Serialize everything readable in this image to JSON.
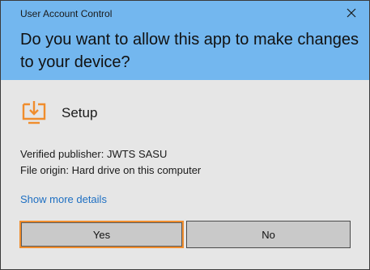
{
  "window": {
    "title": "User Account Control",
    "close_icon": "close-icon"
  },
  "prompt": {
    "question": "Do you want to allow this app to make changes to your device?"
  },
  "app": {
    "icon": "setup-installer-icon",
    "name": "Setup",
    "accent_color": "#f08d2d"
  },
  "info": {
    "publisher": "Verified publisher: JWTS SASU",
    "origin": "File origin: Hard drive on this computer"
  },
  "links": {
    "show_more": "Show more details"
  },
  "buttons": {
    "yes": "Yes",
    "no": "No"
  },
  "colors": {
    "header_bg": "#73b7ef",
    "body_bg": "#e6e6e6",
    "link": "#1e6fc2",
    "focus": "#f08d2d"
  }
}
